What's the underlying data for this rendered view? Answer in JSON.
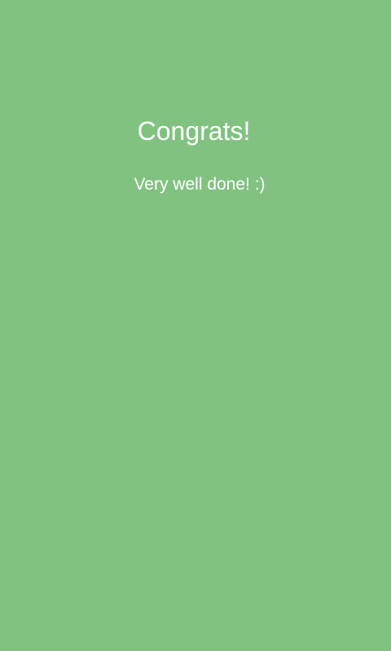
{
  "screen": {
    "title": "Congrats!",
    "message": "Very well done! :)"
  },
  "colors": {
    "background": "#81C281",
    "text": "#FFFFFF"
  }
}
